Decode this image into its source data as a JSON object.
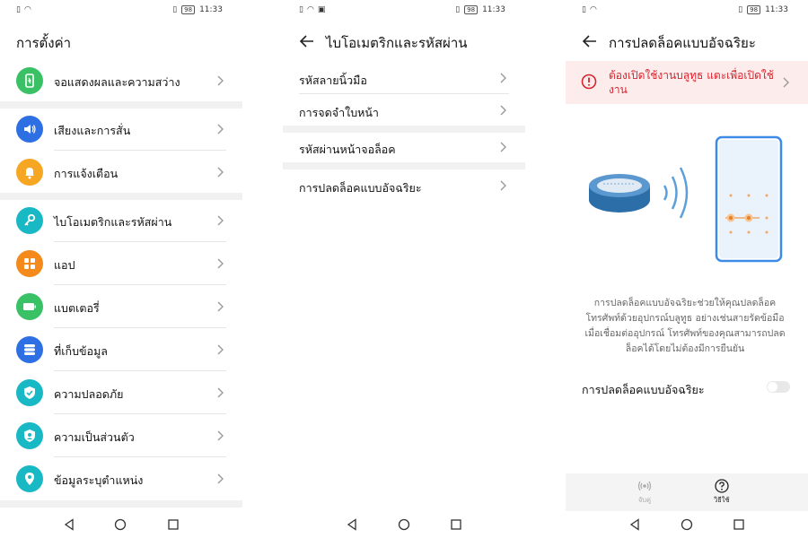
{
  "status": {
    "time": "11:33",
    "battery": "98"
  },
  "panel1": {
    "title": "การตั้งค่า",
    "items": [
      {
        "label": "จอแสดงผลและความสว่าง",
        "color": "#3ac166"
      },
      {
        "label": "เสียงและการสั่น",
        "color": "#2f6fe4"
      },
      {
        "label": "การแจ้งเตือน",
        "color": "#f5a623"
      },
      {
        "label": "ไบโอเมตริกและรหัสผ่าน",
        "color": "#19b8c5"
      },
      {
        "label": "แอป",
        "color": "#f38a1b"
      },
      {
        "label": "แบตเตอรี่",
        "color": "#3ac166"
      },
      {
        "label": "ที่เก็บข้อมูล",
        "color": "#2f6fe4"
      },
      {
        "label": "ความปลอดภัย",
        "color": "#19b8c5"
      },
      {
        "label": "ความเป็นส่วนตัว",
        "color": "#19b8c5"
      },
      {
        "label": "ข้อมูลระบุตำแหน่ง",
        "color": "#19b8c5"
      }
    ]
  },
  "panel2": {
    "title": "ไบโอเมตริกและรหัสผ่าน",
    "items": [
      {
        "label": "รหัสลายนิ้วมือ"
      },
      {
        "label": "การจดจำใบหน้า"
      },
      {
        "label": "รหัสผ่านหน้าจอล็อค"
      },
      {
        "label": "การปลดล็อคแบบอัจฉริยะ"
      }
    ]
  },
  "panel3": {
    "title": "การปลดล็อคแบบอัจฉริยะ",
    "warning": "ต้องเปิดใช้งานบลูทูธ แตะเพื่อเปิดใช้งาน",
    "description": "การปลดล็อคแบบอัจฉริยะช่วยให้คุณปลดล็อคโทรศัพท์ด้วยอุปกรณ์บลูทูธ อย่างเช่นสายรัดข้อมือ เมื่อเชื่อมต่ออุปกรณ์ โทรศัพท์ของคุณสามารถปลดล็อคได้โดยไม่ต้องมีการยืนยัน",
    "toggle_label": "การปลดล็อคแบบอัจฉริยะ",
    "toggle_on": false,
    "bottom": [
      {
        "label": "จับคู่"
      },
      {
        "label": "วิธีใช้"
      }
    ]
  },
  "colors": {
    "accent": "#e67e22",
    "warning": "#d9232d",
    "phone_frame": "#3d8be8"
  }
}
